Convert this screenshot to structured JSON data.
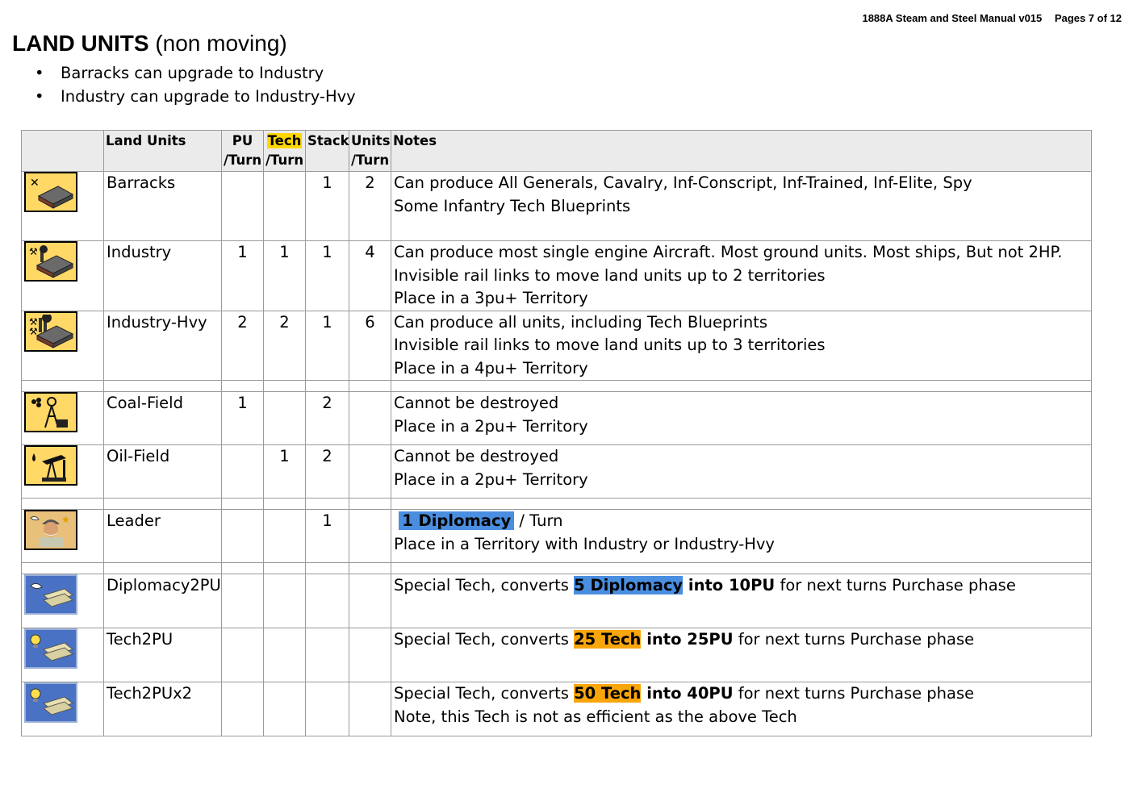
{
  "header": {
    "manual": "1888A Steam and Steel Manual v015",
    "pages": "Pages 7 of 12"
  },
  "title": {
    "main": "LAND UNITS",
    "sub": "(non moving)"
  },
  "bullets": [
    "Barracks can upgrade to Industry",
    "Industry can upgrade to Industry-Hvy"
  ],
  "table": {
    "headers": {
      "land_units": "Land Units",
      "pu_a": "PU",
      "pu_b": "/Turn",
      "tech_a": "Tech",
      "tech_b": "/Turn",
      "stack": "Stack",
      "units_a": "Units",
      "units_b": "/Turn",
      "notes": "Notes"
    },
    "rows": [
      {
        "name": "Barracks",
        "icon": "barracks-icon",
        "pu": "",
        "tech": "",
        "stack": "1",
        "units": "2",
        "notes": [
          "Can produce All Generals, Cavalry, Inf-Conscript, Inf-Trained, Inf-Elite, Spy",
          "Some Infantry Tech Blueprints"
        ]
      },
      {
        "name": "Industry",
        "icon": "industry-icon",
        "pu": "1",
        "tech": "1",
        "stack": "1",
        "units": "4",
        "notes": [
          "Can produce most single engine Aircraft. Most ground units. Most ships,  But not 2HP.",
          "Invisible rail links to move land units up to 2 territories",
          "Place in a 3pu+ Territory"
        ]
      },
      {
        "name": "Industry-Hvy",
        "icon": "industry-hvy-icon",
        "pu": "2",
        "tech": "2",
        "stack": "1",
        "units": "6",
        "notes": [
          "Can produce all units, including Tech Blueprints",
          "Invisible rail links to move land units up to 3 territories",
          "Place in a 4pu+ Territory"
        ]
      },
      {
        "name": "Coal-Field",
        "icon": "coal-field-icon",
        "pu": "1",
        "tech": "",
        "stack": "2",
        "units": "",
        "notes": [
          "Cannot be destroyed",
          "Place in a 2pu+ Territory"
        ]
      },
      {
        "name": "Oil-Field",
        "icon": "oil-field-icon",
        "pu": "",
        "tech": "1",
        "stack": "2",
        "units": "",
        "notes": [
          "Cannot be destroyed",
          "Place in a 2pu+ Territory"
        ]
      },
      {
        "name": "Leader",
        "icon": "leader-icon",
        "pu": "",
        "tech": "",
        "stack": "1",
        "units": "",
        "note_hl": "1 Diplomacy",
        "note_after": " / Turn",
        "note2": "Place in a Territory with Industry or Industry-Hvy"
      },
      {
        "name": "Diplomacy2PU",
        "icon": "diplomacy-card-icon",
        "pu": "",
        "tech": "",
        "stack": "",
        "units": "",
        "pre": "Special Tech, converts ",
        "hl": "5 Diplomacy",
        "bold": " into 10PU",
        "post": " for next turns Purchase phase"
      },
      {
        "name": "Tech2PU",
        "icon": "tech-card-icon",
        "pu": "",
        "tech": "",
        "stack": "",
        "units": "",
        "pre": "Special Tech, converts ",
        "hl": "25 Tech",
        "bold": " into 25PU",
        "post": " for next turns Purchase phase"
      },
      {
        "name": "Tech2PUx2",
        "icon": "tech-card-icon",
        "pu": "",
        "tech": "",
        "stack": "",
        "units": "",
        "pre": "Special Tech, converts ",
        "hl": "50 Tech",
        "bold": " into 40PU",
        "post": " for next turns Purchase phase",
        "note2": "Note, this Tech is not as efficient as the above Tech"
      }
    ]
  },
  "colors": {
    "tech_header": "#ffd700",
    "diplomacy_highlight": "#4a8ee0",
    "tech_highlight": "#f9a60c",
    "header_bg": "#ebebeb"
  }
}
